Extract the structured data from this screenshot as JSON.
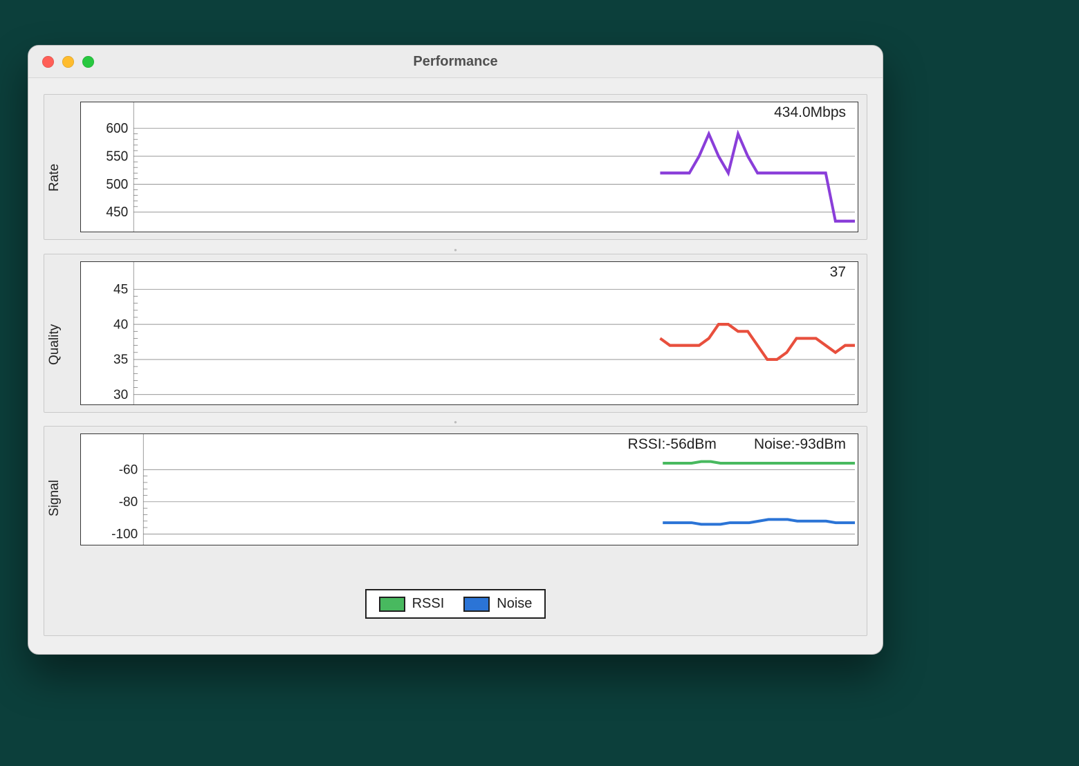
{
  "window": {
    "title": "Performance"
  },
  "rate": {
    "ylabel": "Rate",
    "readout": "434.0Mbps",
    "unit": "Mbps",
    "ticks": [
      450,
      500,
      550,
      600
    ],
    "ylim": [
      420,
      610
    ],
    "color": "#8a3ed9"
  },
  "quality": {
    "ylabel": "Quality",
    "readout": "37",
    "ticks": [
      30,
      35,
      40,
      45
    ],
    "ylim": [
      29,
      46
    ],
    "color": "#e84f3d"
  },
  "signal": {
    "ylabel": "Signal",
    "readout_rssi": "RSSI:-56dBm",
    "readout_noise": "Noise:-93dBm",
    "ticks": [
      -100,
      -80,
      -60
    ],
    "ylim": [
      -105,
      -50
    ],
    "color_rssi": "#48b95f",
    "color_noise": "#2b74d6",
    "legend_rssi": "RSSI",
    "legend_noise": "Noise"
  },
  "chart_data": [
    {
      "type": "line",
      "title": "Rate",
      "ylabel": "Rate",
      "xlabel": "",
      "ylim": [
        420,
        610
      ],
      "x": [
        0,
        1,
        2,
        3,
        4,
        5,
        6,
        7,
        8,
        9,
        10,
        11,
        12,
        13,
        14,
        15,
        16,
        17,
        18,
        19,
        20
      ],
      "series": [
        {
          "name": "Rate (Mbps)",
          "color": "#8a3ed9",
          "values": [
            520,
            520,
            520,
            520,
            550,
            590,
            550,
            520,
            590,
            550,
            520,
            520,
            520,
            520,
            520,
            520,
            520,
            520,
            434,
            434,
            434
          ]
        }
      ],
      "annotations": [
        "434.0Mbps"
      ]
    },
    {
      "type": "line",
      "title": "Quality",
      "ylabel": "Quality",
      "xlabel": "",
      "ylim": [
        29,
        46
      ],
      "x": [
        0,
        1,
        2,
        3,
        4,
        5,
        6,
        7,
        8,
        9,
        10,
        11,
        12,
        13,
        14,
        15,
        16,
        17,
        18,
        19,
        20
      ],
      "series": [
        {
          "name": "Quality",
          "color": "#e84f3d",
          "values": [
            38,
            37,
            37,
            37,
            37,
            38,
            40,
            40,
            39,
            39,
            37,
            35,
            35,
            36,
            38,
            38,
            38,
            37,
            36,
            37,
            37
          ]
        }
      ],
      "annotations": [
        "37"
      ]
    },
    {
      "type": "line",
      "title": "Signal",
      "ylabel": "Signal",
      "xlabel": "",
      "ylim": [
        -105,
        -50
      ],
      "x": [
        0,
        1,
        2,
        3,
        4,
        5,
        6,
        7,
        8,
        9,
        10,
        11,
        12,
        13,
        14,
        15,
        16,
        17,
        18,
        19,
        20
      ],
      "series": [
        {
          "name": "RSSI (dBm)",
          "color": "#48b95f",
          "values": [
            -56,
            -56,
            -56,
            -56,
            -55,
            -55,
            -56,
            -56,
            -56,
            -56,
            -56,
            -56,
            -56,
            -56,
            -56,
            -56,
            -56,
            -56,
            -56,
            -56,
            -56
          ]
        },
        {
          "name": "Noise (dBm)",
          "color": "#2b74d6",
          "values": [
            -93,
            -93,
            -93,
            -93,
            -94,
            -94,
            -94,
            -93,
            -93,
            -93,
            -92,
            -91,
            -91,
            -91,
            -92,
            -92,
            -92,
            -92,
            -93,
            -93,
            -93
          ]
        }
      ],
      "annotations": [
        "RSSI:-56dBm",
        "Noise:-93dBm"
      ],
      "legend": [
        "RSSI",
        "Noise"
      ]
    }
  ]
}
